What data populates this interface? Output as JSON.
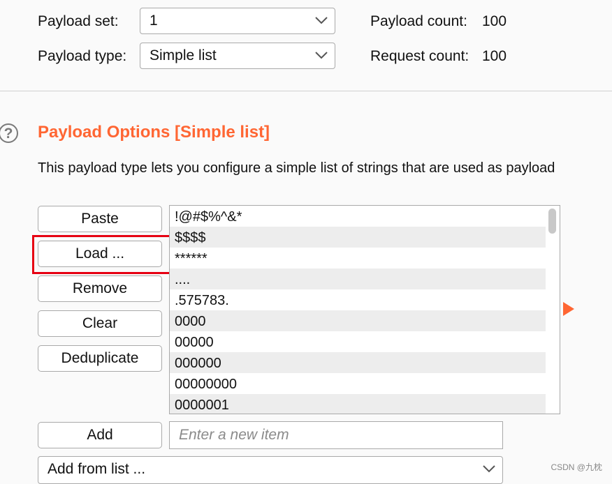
{
  "payload_set": {
    "label": "Payload set:",
    "value": "1"
  },
  "payload_type": {
    "label": "Payload type:",
    "value": "Simple list"
  },
  "payload_count": {
    "label": "Payload count:",
    "value": "100"
  },
  "request_count": {
    "label": "Request count:",
    "value": "100"
  },
  "section": {
    "title": "Payload Options [Simple list]",
    "description": "This payload type lets you configure a simple list of strings that are used as payload",
    "help_glyph": "?"
  },
  "buttons": {
    "paste": "Paste",
    "load": "Load ...",
    "remove": "Remove",
    "clear": "Clear",
    "deduplicate": "Deduplicate",
    "add": "Add"
  },
  "list_items": [
    "!@#$%^&*",
    "$$$$",
    "******",
    "....",
    ".575783.",
    "0000",
    "00000",
    "000000",
    "00000000",
    "0000001"
  ],
  "add_input": {
    "placeholder": "Enter a new item",
    "value": ""
  },
  "add_from_list": {
    "value": "Add from list ..."
  },
  "watermark": "CSDN @九枕",
  "colors": {
    "accent": "#ff6633",
    "highlight": "#e60012"
  }
}
